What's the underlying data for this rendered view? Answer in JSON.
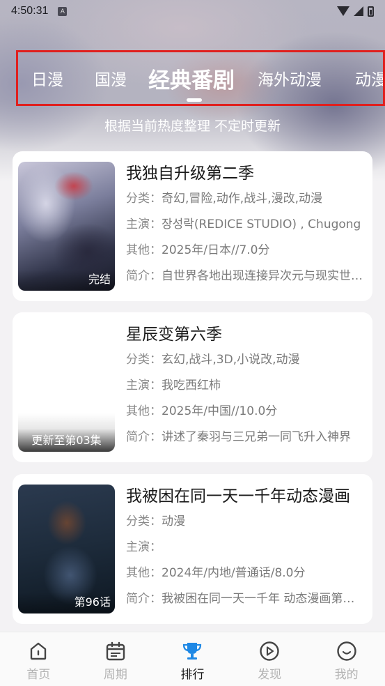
{
  "status_bar": {
    "time": "4:50:31",
    "notif_glyph": "A"
  },
  "tabs": [
    {
      "label": "日漫",
      "active": false
    },
    {
      "label": "国漫",
      "active": false
    },
    {
      "label": "经典番剧",
      "active": true
    },
    {
      "label": "海外动漫",
      "active": false
    },
    {
      "label": "动漫",
      "active": false
    }
  ],
  "subtitle": "根据当前热度整理 不定时更新",
  "labels": {
    "category": "分类：",
    "cast": "主演：",
    "other": "其他：",
    "intro": "简介："
  },
  "items": [
    {
      "title": "我独自升级第二季",
      "badge": "完结",
      "category": "奇幻,冒险,动作,战斗,漫改,动漫",
      "cast": "장성락(REDICE STUDIO) , Chugong",
      "other": "2025年/日本//7.0分",
      "intro": "自世界各地出现连接异次元与现实世界的通道"
    },
    {
      "title": "星辰变第六季",
      "badge": "更新至第03集",
      "category": "玄幻,战斗,3D,小说改,动漫",
      "cast": "我吃西红柿",
      "other": "2025年/中国//10.0分",
      "intro": "讲述了秦羽与三兄弟一同飞升入神界"
    },
    {
      "title": "我被困在同一天一千年动态漫画",
      "badge": "第96话",
      "category": "动漫",
      "cast": "",
      "other": "2024年/内地/普通话/8.0分",
      "intro": "我被困在同一天一千年 动态漫画第一季"
    }
  ],
  "bottom_nav": [
    {
      "label": "首页",
      "icon": "home-icon",
      "active": false
    },
    {
      "label": "周期",
      "icon": "calendar-icon",
      "active": false
    },
    {
      "label": "排行",
      "icon": "trophy-icon",
      "active": true
    },
    {
      "label": "发现",
      "icon": "play-circle-icon",
      "active": false
    },
    {
      "label": "我的",
      "icon": "smile-icon",
      "active": false
    }
  ],
  "colors": {
    "accent": "#1e88e5",
    "highlight_box": "#e0201e",
    "text_primary": "#1a1a1a",
    "text_secondary": "#7a7a7a"
  }
}
